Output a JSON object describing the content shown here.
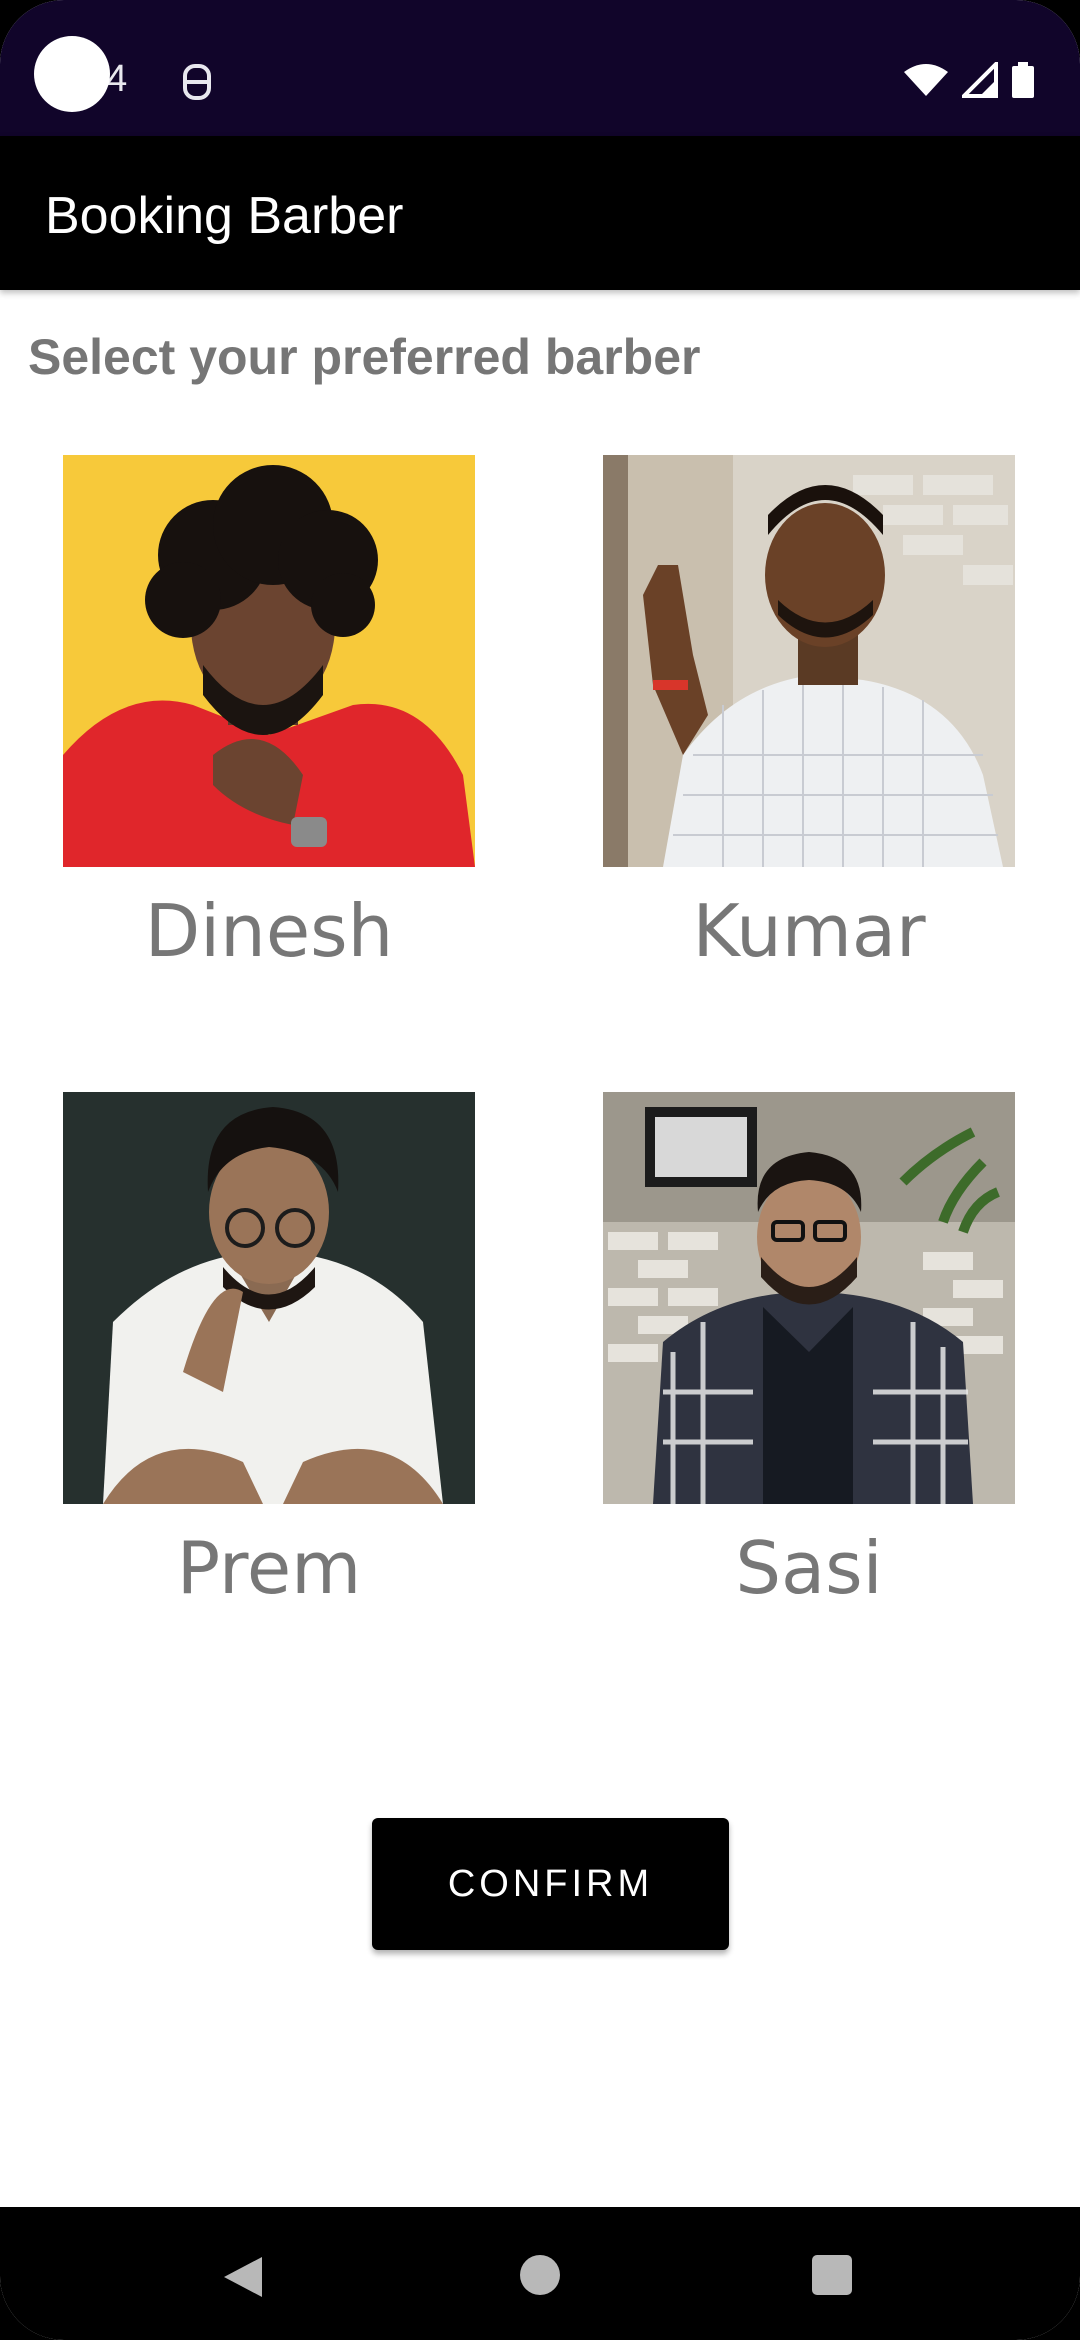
{
  "status_bar": {
    "time": "14"
  },
  "app_bar": {
    "title": "Booking Barber"
  },
  "main": {
    "subtitle": "Select your preferred barber",
    "barbers": [
      {
        "name": "Dinesh",
        "photo_bg": "#f7c93a",
        "shirt": "#e0262b"
      },
      {
        "name": "Kumar",
        "photo_bg": "#d9d3c8",
        "shirt": "#eef0f2"
      },
      {
        "name": "Prem",
        "photo_bg": "#26302e",
        "shirt": "#f1f1ee"
      },
      {
        "name": "Sasi",
        "photo_bg": "#bdb8ad",
        "shirt": "#2f3340"
      }
    ],
    "confirm_label": "CONFIRM"
  },
  "colors": {
    "status_bar": "#11052a",
    "app_bar": "#000000",
    "subtitle_text": "#767676",
    "name_text": "#777777"
  }
}
